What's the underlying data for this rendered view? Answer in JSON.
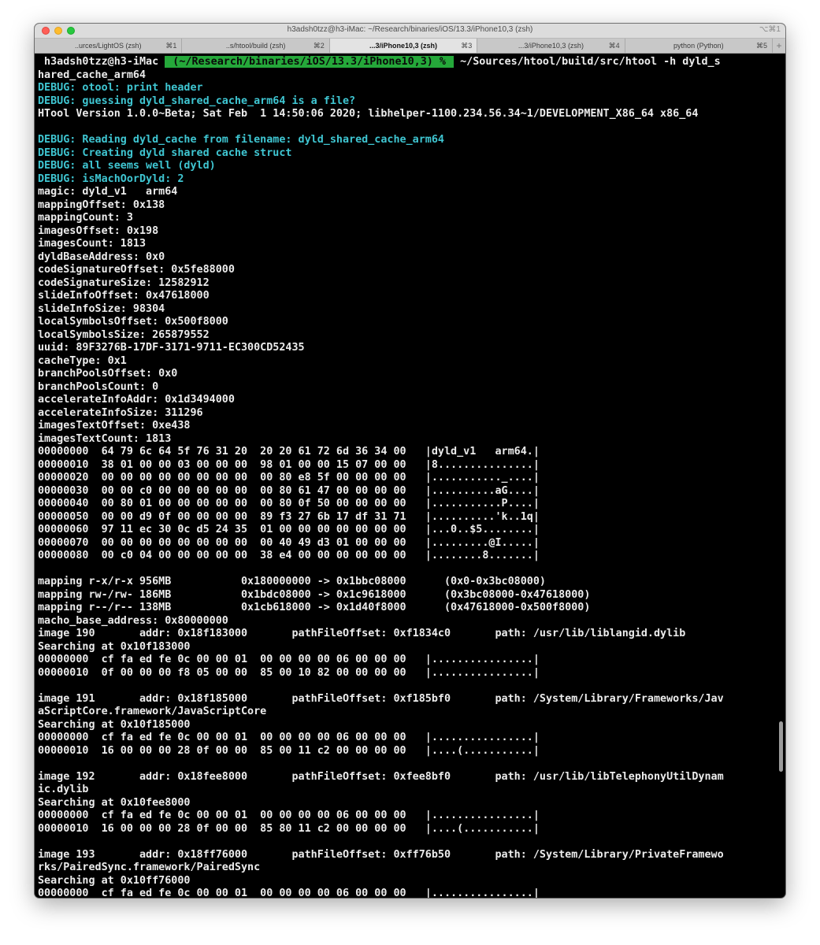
{
  "window": {
    "title": "h3adsh0tzz@h3-iMac: ~/Research/binaries/iOS/13.3/iPhone10,3 (zsh)",
    "title_shortcut": "⌥⌘1"
  },
  "tabs": [
    {
      "label": "..urces/LightOS (zsh)",
      "shortcut": "⌘1"
    },
    {
      "label": "..s/htool/build (zsh)",
      "shortcut": "⌘2"
    },
    {
      "label": "...3/iPhone10,3 (zsh)",
      "shortcut": "⌘3"
    },
    {
      "label": "...3/iPhone10,3 (zsh)",
      "shortcut": "⌘4"
    },
    {
      "label": "python (Python)",
      "shortcut": "⌘5"
    }
  ],
  "tab_add_label": "+",
  "colors": {
    "debug": "#3fc6d2",
    "prompt_bg": "#25a83a",
    "text": "#ececec"
  },
  "prompt": {
    "user": " h3adsh0tzz@h3-iMac ",
    "path": " (~/Research/binaries/iOS/13.3/iPhone10,3) % ",
    "command": " ~/Sources/htool/build/src/htool -h dyld_s"
  },
  "lines": [
    "hared_cache_arm64",
    "DEBUG: otool: print header",
    "DEBUG: guessing dyld_shared_cache_arm64 is a file?",
    "HTool Version 1.0.0~Beta; Sat Feb  1 14:50:06 2020; libhelper-1100.234.56.34~1/DEVELOPMENT_X86_64 x86_64",
    "",
    "DEBUG: Reading dyld_cache from filename: dyld_shared_cache_arm64",
    "DEBUG: Creating dyld shared cache struct",
    "DEBUG: all seems well (dyld)",
    "DEBUG: isMachOorDyld: 2",
    "magic: dyld_v1   arm64",
    "mappingOffset: 0x138",
    "mappingCount: 3",
    "imagesOffset: 0x198",
    "imagesCount: 1813",
    "dyldBaseAddress: 0x0",
    "codeSignatureOffset: 0x5fe88000",
    "codeSignatureSize: 12582912",
    "slideInfoOffset: 0x47618000",
    "slideInfoSize: 98304",
    "localSymbolsOffset: 0x500f8000",
    "localSymbolsSize: 265879552",
    "uuid: 89F3276B-17DF-3171-9711-EC300CD52435",
    "cacheType: 0x1",
    "branchPoolsOffset: 0x0",
    "branchPoolsCount: 0",
    "accelerateInfoAddr: 0x1d3494000",
    "accelerateInfoSize: 311296",
    "imagesTextOffset: 0xe438",
    "imagesTextCount: 1813",
    "00000000  64 79 6c 64 5f 76 31 20  20 20 61 72 6d 36 34 00   |dyld_v1   arm64.|",
    "00000010  38 01 00 00 03 00 00 00  98 01 00 00 15 07 00 00   |8...............|",
    "00000020  00 00 00 00 00 00 00 00  00 80 e8 5f 00 00 00 00   |..........._....|",
    "00000030  00 00 c0 00 00 00 00 00  00 80 61 47 00 00 00 00   |..........aG....|",
    "00000040  00 80 01 00 00 00 00 00  00 80 0f 50 00 00 00 00   |...........P....|",
    "00000050  00 00 d9 0f 00 00 00 00  89 f3 27 6b 17 df 31 71   |..........'k..1q|",
    "00000060  97 11 ec 30 0c d5 24 35  01 00 00 00 00 00 00 00   |...0..$5........|",
    "00000070  00 00 00 00 00 00 00 00  00 40 49 d3 01 00 00 00   |.........@I.....|",
    "00000080  00 c0 04 00 00 00 00 00  38 e4 00 00 00 00 00 00   |........8.......|",
    "",
    "mapping r-x/r-x 956MB           0x180000000 -> 0x1bbc08000      (0x0-0x3bc08000)",
    "mapping rw-/rw- 186MB           0x1bdc08000 -> 0x1c9618000      (0x3bc08000-0x47618000)",
    "mapping r--/r-- 138MB           0x1cb618000 -> 0x1d40f8000      (0x47618000-0x500f8000)",
    "macho_base_address: 0x80000000",
    "image 190       addr: 0x18f183000       pathFileOffset: 0xf1834c0       path: /usr/lib/liblangid.dylib",
    "Searching at 0x10f183000",
    "00000000  cf fa ed fe 0c 00 00 01  00 00 00 00 06 00 00 00   |................|",
    "00000010  0f 00 00 00 f8 05 00 00  85 00 10 82 00 00 00 00   |................|",
    "",
    "image 191       addr: 0x18f185000       pathFileOffset: 0xf185bf0       path: /System/Library/Frameworks/Jav",
    "aScriptCore.framework/JavaScriptCore",
    "Searching at 0x10f185000",
    "00000000  cf fa ed fe 0c 00 00 01  00 00 00 00 06 00 00 00   |................|",
    "00000010  16 00 00 00 28 0f 00 00  85 00 11 c2 00 00 00 00   |....(...........|",
    "",
    "image 192       addr: 0x18fee8000       pathFileOffset: 0xfee8bf0       path: /usr/lib/libTelephonyUtilDynam",
    "ic.dylib",
    "Searching at 0x10fee8000",
    "00000000  cf fa ed fe 0c 00 00 01  00 00 00 00 06 00 00 00   |................|",
    "00000010  16 00 00 00 28 0f 00 00  85 80 11 c2 00 00 00 00   |....(...........|",
    "",
    "image 193       addr: 0x18ff76000       pathFileOffset: 0xff76b50       path: /System/Library/PrivateFramewo",
    "rks/PairedSync.framework/PairedSync",
    "Searching at 0x10ff76000",
    "00000000  cf fa ed fe 0c 00 00 01  00 00 00 00 06 00 00 00   |................|"
  ]
}
